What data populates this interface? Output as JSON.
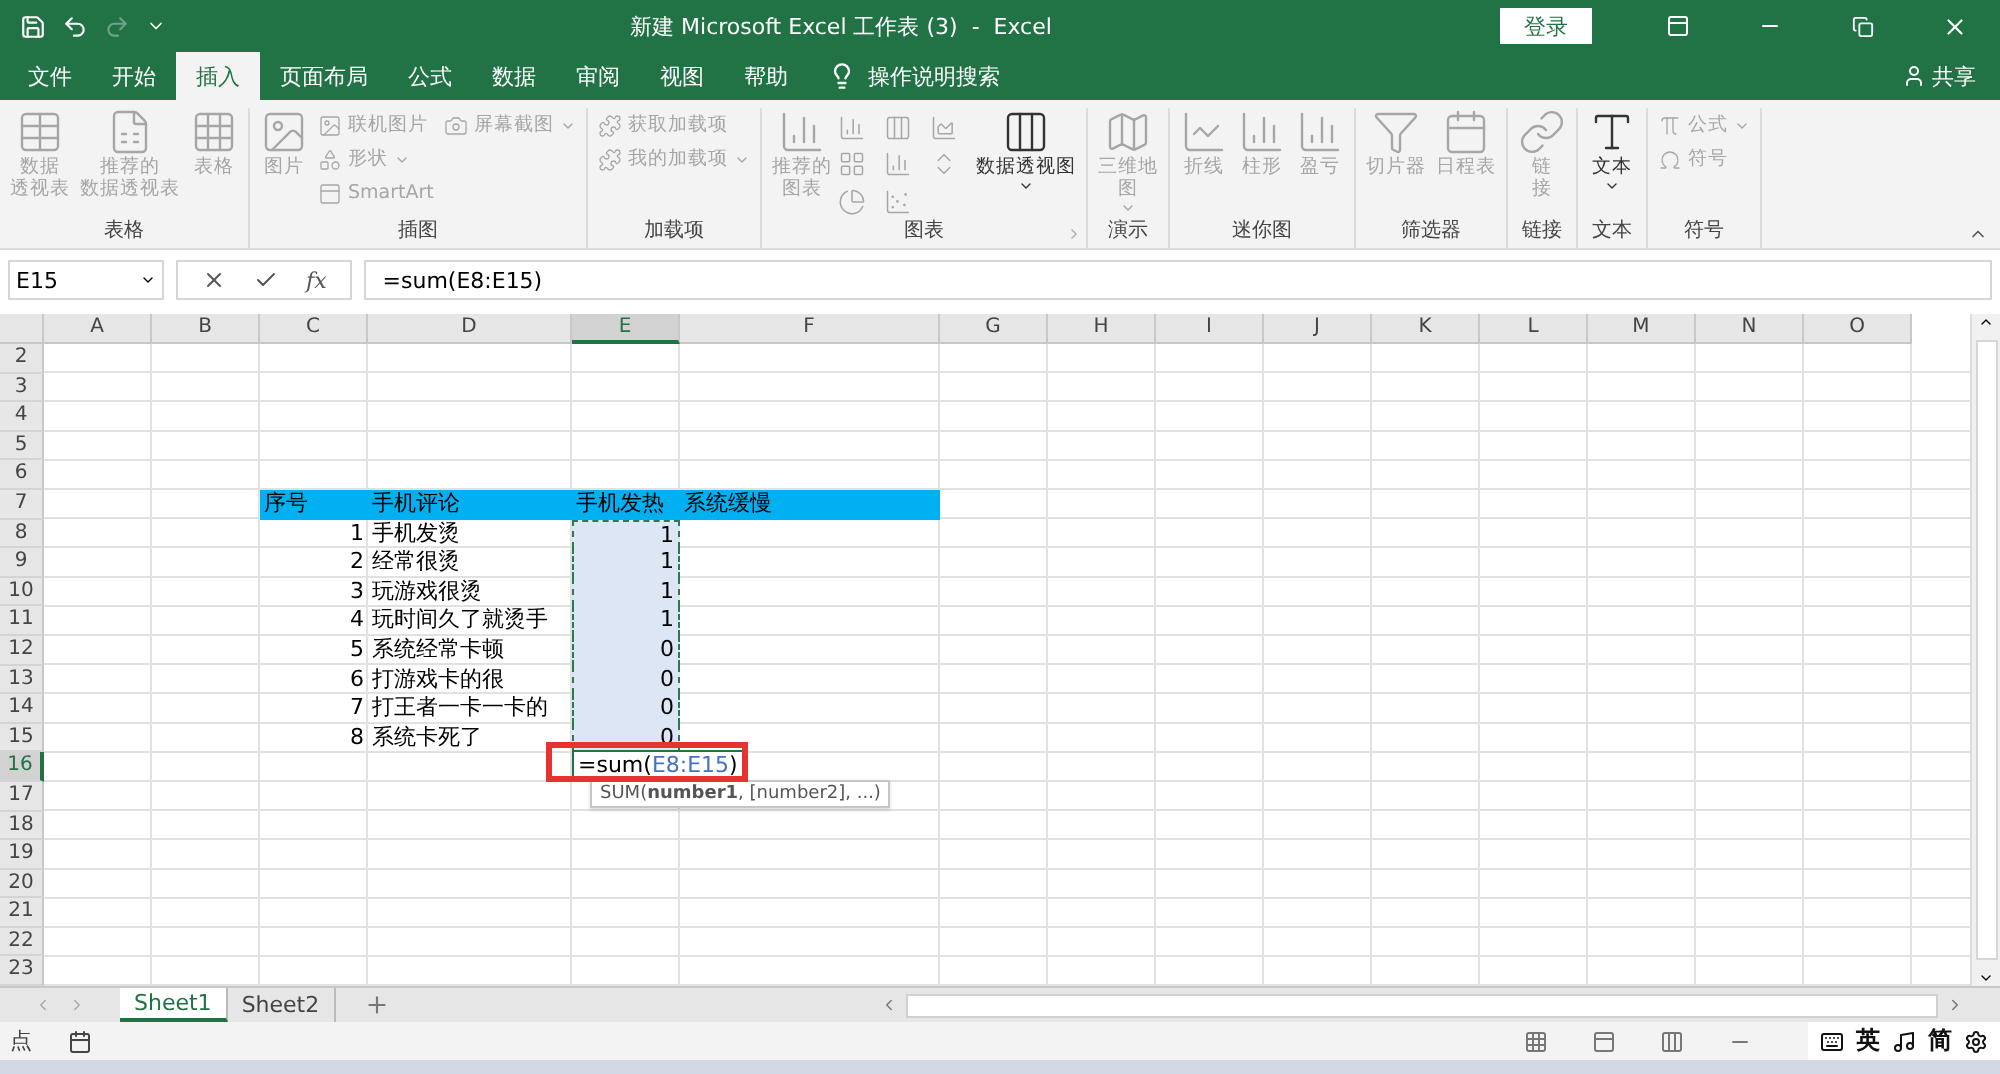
{
  "window": {
    "title": "新建 Microsoft Excel 工作表 (3)  -  Excel",
    "login_button": "登录",
    "redo_disabled": true
  },
  "ribbon_tabs": [
    {
      "label": "文件",
      "selected": false
    },
    {
      "label": "开始",
      "selected": false
    },
    {
      "label": "插入",
      "selected": true
    },
    {
      "label": "页面布局",
      "selected": false
    },
    {
      "label": "公式",
      "selected": false
    },
    {
      "label": "数据",
      "selected": false
    },
    {
      "label": "审阅",
      "selected": false
    },
    {
      "label": "视图",
      "selected": false
    },
    {
      "label": "帮助",
      "selected": false
    }
  ],
  "tell_me": "操作说明搜索",
  "share": "共享",
  "ribbon_groups": [
    {
      "label": "表格",
      "items": [
        {
          "kind": "large",
          "lines": [
            "数据",
            "透视表"
          ],
          "disabled": true
        },
        {
          "kind": "large",
          "lines": [
            "推荐的",
            "数据透视表"
          ],
          "disabled": true
        },
        {
          "kind": "large",
          "label": "表格",
          "disabled": true
        }
      ]
    },
    {
      "label": "插图",
      "items": [
        {
          "kind": "large",
          "label": "图片",
          "disabled": true
        },
        {
          "kind": "stack",
          "items": [
            {
              "label": "联机图片",
              "dropdown": false
            },
            {
              "label": "形状",
              "dropdown": true
            },
            {
              "label": "SmartArt",
              "dropdown": false
            }
          ],
          "disabled": true
        },
        {
          "kind": "stack",
          "items": [
            {
              "label": "屏幕截图",
              "dropdown": true
            }
          ],
          "disabled": true
        }
      ]
    },
    {
      "label": "加载项",
      "items": [
        {
          "kind": "stack",
          "items": [
            {
              "label": "获取加载项",
              "dropdown": false
            },
            {
              "label": "我的加载项",
              "dropdown": true
            }
          ],
          "disabled": true
        }
      ]
    },
    {
      "label": "图表",
      "items": [
        {
          "kind": "large",
          "lines": [
            "推荐的",
            "图表"
          ],
          "disabled": true
        },
        {
          "kind": "charts",
          "disabled": true
        },
        {
          "kind": "large",
          "label": "数据透视图",
          "dropdown": true,
          "disabled": false
        }
      ],
      "launcher": true
    },
    {
      "label": "演示",
      "items": [
        {
          "kind": "large",
          "lines": [
            "三维地",
            "图"
          ],
          "dropdown": true,
          "disabled": true
        }
      ]
    },
    {
      "label": "迷你图",
      "items": [
        {
          "kind": "large",
          "label": "折线",
          "disabled": true
        },
        {
          "kind": "large",
          "label": "柱形",
          "disabled": true
        },
        {
          "kind": "large",
          "label": "盈亏",
          "disabled": true
        }
      ]
    },
    {
      "label": "筛选器",
      "items": [
        {
          "kind": "large",
          "label": "切片器",
          "disabled": true
        },
        {
          "kind": "large",
          "label": "日程表",
          "disabled": true
        }
      ]
    },
    {
      "label": "链接",
      "items": [
        {
          "kind": "large",
          "lines": [
            "链",
            "接"
          ],
          "disabled": true
        }
      ]
    },
    {
      "label": "文本",
      "items": [
        {
          "kind": "large",
          "label": "文本",
          "dropdown": true,
          "disabled": false
        }
      ]
    },
    {
      "label": "符号",
      "items": [
        {
          "kind": "stack",
          "items": [
            {
              "label": "公式",
              "dropdown": true
            },
            {
              "label": "符号",
              "dropdown": false
            }
          ],
          "disabled": true
        }
      ]
    }
  ],
  "formula_bar": {
    "name_box": "E15",
    "function_label": "fx",
    "formula": "=sum(E8:E15)"
  },
  "columns": [
    {
      "label": "A",
      "selected": false
    },
    {
      "label": "B",
      "selected": false
    },
    {
      "label": "C",
      "selected": false
    },
    {
      "label": "D",
      "selected": false
    },
    {
      "label": "E",
      "selected": true
    },
    {
      "label": "F",
      "selected": false
    },
    {
      "label": "G",
      "selected": false
    },
    {
      "label": "H",
      "selected": false
    },
    {
      "label": "I",
      "selected": false
    },
    {
      "label": "J",
      "selected": false
    },
    {
      "label": "K",
      "selected": false
    },
    {
      "label": "L",
      "selected": false
    },
    {
      "label": "M",
      "selected": false
    },
    {
      "label": "N",
      "selected": false
    },
    {
      "label": "O",
      "selected": false
    }
  ],
  "rows": [
    {
      "number": "2",
      "selected": false
    },
    {
      "number": "3",
      "selected": false
    },
    {
      "number": "4",
      "selected": false
    },
    {
      "number": "5",
      "selected": false
    },
    {
      "number": "6",
      "selected": false
    },
    {
      "number": "7",
      "selected": false,
      "kind": "header",
      "cells": [
        "序号",
        "手机评论",
        "手机发热",
        "系统缓慢"
      ]
    },
    {
      "number": "8",
      "selected": false,
      "kind": "data",
      "cells": [
        "1",
        "手机发烫",
        "1"
      ],
      "in_range": true
    },
    {
      "number": "9",
      "selected": false,
      "kind": "data",
      "cells": [
        "2",
        "经常很烫",
        "1"
      ],
      "in_range": true
    },
    {
      "number": "10",
      "selected": false,
      "kind": "data",
      "cells": [
        "3",
        "玩游戏很烫",
        "1"
      ],
      "in_range": true
    },
    {
      "number": "11",
      "selected": false,
      "kind": "data",
      "cells": [
        "4",
        "玩时间久了就烫手",
        "1"
      ],
      "in_range": true
    },
    {
      "number": "12",
      "selected": false,
      "kind": "data",
      "cells": [
        "5",
        "系统经常卡顿",
        "0"
      ],
      "in_range": true
    },
    {
      "number": "13",
      "selected": false,
      "kind": "data",
      "cells": [
        "6",
        "打游戏卡的很",
        "0"
      ],
      "in_range": true
    },
    {
      "number": "14",
      "selected": false,
      "kind": "data",
      "cells": [
        "7",
        "打王者一卡一卡的",
        "0"
      ],
      "in_range": true
    },
    {
      "number": "15",
      "selected": false,
      "kind": "data",
      "cells": [
        "8",
        "系统卡死了",
        "0"
      ],
      "in_range": true
    },
    {
      "number": "16",
      "selected": true,
      "kind": "edit",
      "editor": {
        "prefix": "=sum(",
        "reference": "E8:E15",
        "suffix": ")"
      },
      "tooltip": "SUM(**number1**, [number2], ...)"
    },
    {
      "number": "17",
      "selected": false
    },
    {
      "number": "18",
      "selected": false
    },
    {
      "number": "19",
      "selected": false
    },
    {
      "number": "20",
      "selected": false
    },
    {
      "number": "21",
      "selected": false
    },
    {
      "number": "22",
      "selected": false
    },
    {
      "number": "23",
      "selected": false
    }
  ],
  "sheet_tabs": [
    {
      "label": "Sheet1",
      "selected": true
    },
    {
      "label": "Sheet2",
      "selected": false
    }
  ],
  "status_bar": {
    "mode": "点"
  },
  "ime_bar": {
    "items": [
      "英",
      "简"
    ]
  }
}
